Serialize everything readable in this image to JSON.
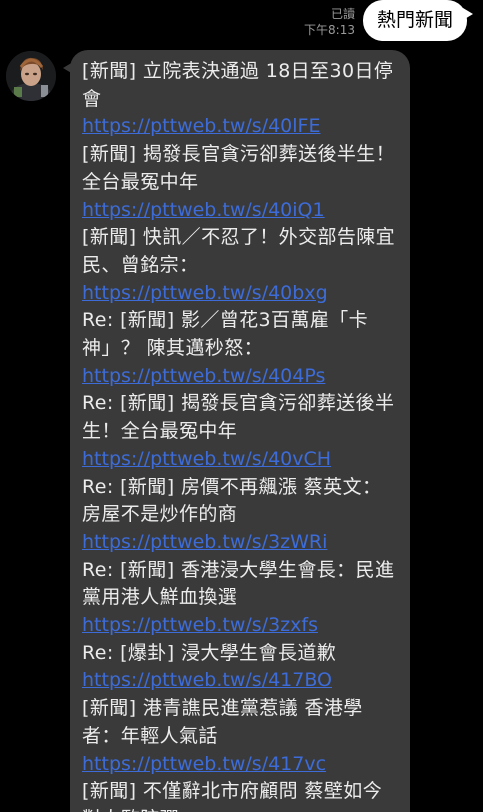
{
  "outgoing": {
    "read_status": "已讀",
    "time": "下午8:13",
    "text": "熱門新聞"
  },
  "incoming": {
    "avatar_icon": "user-avatar-icon",
    "link_color": "#3d6cd8",
    "bubble_color": "#3a3a3a",
    "news": [
      {
        "title": "[新聞] 立院表決通過 18日至30日停會",
        "url": "https://pttweb.tw/s/40lFE"
      },
      {
        "title": "[新聞] 揭發長官貪污卻葬送後半生！全台最冤中年",
        "url": "https://pttweb.tw/s/40iQ1"
      },
      {
        "title": "[新聞] 快訊／不忍了！外交部告陳宜民、曾銘宗：",
        "url": "https://pttweb.tw/s/40bxg"
      },
      {
        "title": "Re: [新聞] 影／曾花3百萬雇「卡神」？ 陳其邁秒怒：",
        "url": "https://pttweb.tw/s/404Ps"
      },
      {
        "title": "Re: [新聞] 揭發長官貪污卻葬送後半生！全台最冤中年",
        "url": "https://pttweb.tw/s/40vCH"
      },
      {
        "title": "Re: [新聞] 房價不再飆漲 蔡英文：房屋不是炒作的商",
        "url": "https://pttweb.tw/s/3zWRi"
      },
      {
        "title": "Re: [新聞] 香港浸大學生會長：民進黨用港人鮮血換選",
        "url": "https://pttweb.tw/s/3zxfs"
      },
      {
        "title": "Re: [爆卦] 浸大學生會長道歉",
        "url": "https://pttweb.tw/s/417BO"
      },
      {
        "title": "[新聞] 港青譙民進黨惹議 香港學者：年輕人氣話",
        "url": "https://pttweb.tw/s/417vc"
      },
      {
        "title": "[新聞] 不僅辭北市府顧問 蔡壁如今對人監院彈",
        "url": ""
      }
    ]
  }
}
